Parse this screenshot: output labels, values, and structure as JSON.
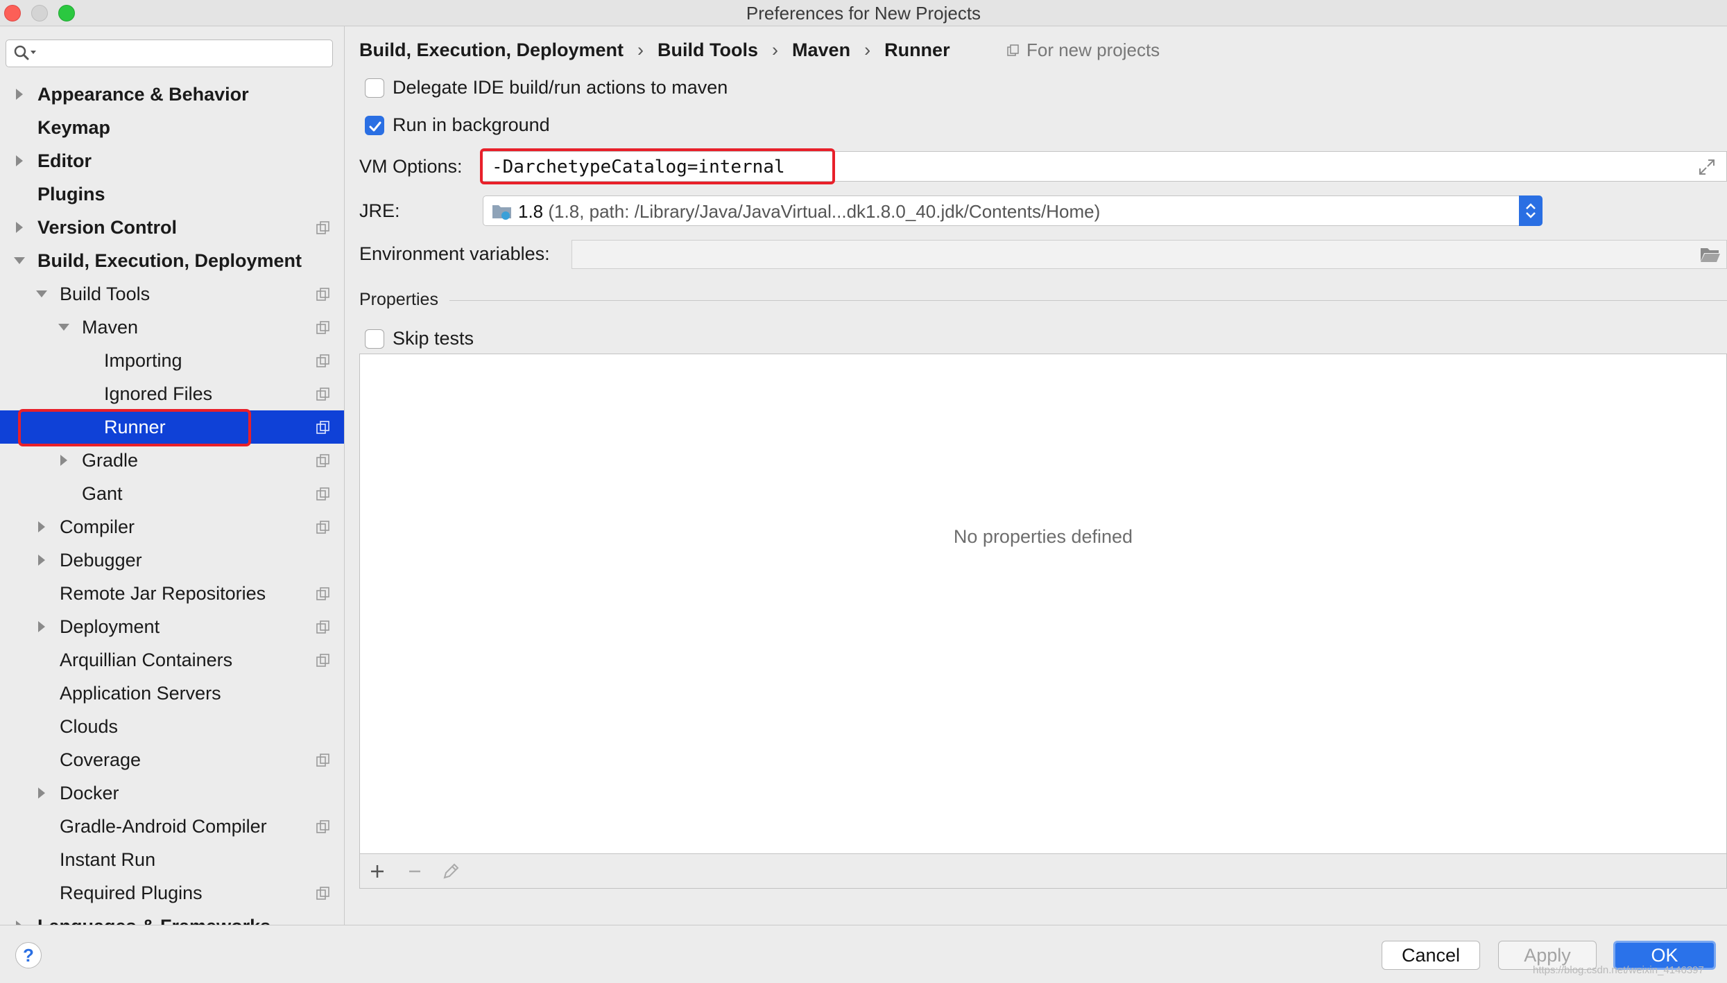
{
  "window": {
    "title": "Preferences for New Projects"
  },
  "sidebar": {
    "search": {
      "value": "",
      "placeholder": ""
    },
    "items": [
      {
        "label": "Appearance & Behavior",
        "level": 0,
        "arrow": "right",
        "bold": true,
        "copy": false
      },
      {
        "label": "Keymap",
        "level": 0,
        "arrow": "none",
        "bold": true,
        "copy": false
      },
      {
        "label": "Editor",
        "level": 0,
        "arrow": "right",
        "bold": true,
        "copy": false
      },
      {
        "label": "Plugins",
        "level": 0,
        "arrow": "none",
        "bold": true,
        "copy": false
      },
      {
        "label": "Version Control",
        "level": 0,
        "arrow": "right",
        "bold": true,
        "copy": true
      },
      {
        "label": "Build, Execution, Deployment",
        "level": 0,
        "arrow": "down",
        "bold": true,
        "copy": false
      },
      {
        "label": "Build Tools",
        "level": 1,
        "arrow": "down",
        "bold": false,
        "copy": true
      },
      {
        "label": "Maven",
        "level": 2,
        "arrow": "down",
        "bold": false,
        "copy": true
      },
      {
        "label": "Importing",
        "level": 3,
        "arrow": "none",
        "bold": false,
        "copy": true
      },
      {
        "label": "Ignored Files",
        "level": 3,
        "arrow": "none",
        "bold": false,
        "copy": true
      },
      {
        "label": "Runner",
        "level": 3,
        "arrow": "none",
        "bold": false,
        "copy": true,
        "selected": true
      },
      {
        "label": "Gradle",
        "level": 2,
        "arrow": "right",
        "bold": false,
        "copy": true
      },
      {
        "label": "Gant",
        "level": 2,
        "arrow": "none",
        "bold": false,
        "copy": true
      },
      {
        "label": "Compiler",
        "level": 1,
        "arrow": "right",
        "bold": false,
        "copy": true
      },
      {
        "label": "Debugger",
        "level": 1,
        "arrow": "right",
        "bold": false,
        "copy": false
      },
      {
        "label": "Remote Jar Repositories",
        "level": 1,
        "arrow": "none",
        "bold": false,
        "copy": true
      },
      {
        "label": "Deployment",
        "level": 1,
        "arrow": "right",
        "bold": false,
        "copy": true
      },
      {
        "label": "Arquillian Containers",
        "level": 1,
        "arrow": "none",
        "bold": false,
        "copy": true
      },
      {
        "label": "Application Servers",
        "level": 1,
        "arrow": "none",
        "bold": false,
        "copy": false
      },
      {
        "label": "Clouds",
        "level": 1,
        "arrow": "none",
        "bold": false,
        "copy": false
      },
      {
        "label": "Coverage",
        "level": 1,
        "arrow": "none",
        "bold": false,
        "copy": true
      },
      {
        "label": "Docker",
        "level": 1,
        "arrow": "right",
        "bold": false,
        "copy": false
      },
      {
        "label": "Gradle-Android Compiler",
        "level": 1,
        "arrow": "none",
        "bold": false,
        "copy": true
      },
      {
        "label": "Instant Run",
        "level": 1,
        "arrow": "none",
        "bold": false,
        "copy": false
      },
      {
        "label": "Required Plugins",
        "level": 1,
        "arrow": "none",
        "bold": false,
        "copy": true
      },
      {
        "label": "Languages & Frameworks",
        "level": 0,
        "arrow": "right",
        "bold": true,
        "copy": false
      }
    ]
  },
  "breadcrumb": {
    "items": [
      "Build, Execution, Deployment",
      "Build Tools",
      "Maven",
      "Runner"
    ],
    "separator": "›",
    "scope_note": "For new projects"
  },
  "runner": {
    "delegate_label": "Delegate IDE build/run actions to maven",
    "delegate_checked": false,
    "background_label": "Run in background",
    "background_checked": true,
    "vm_options_label": "VM Options:",
    "vm_options_value": "-DarchetypeCatalog=internal",
    "jre_label": "JRE:",
    "jre_version": "1.8",
    "jre_path": "(1.8, path: /Library/Java/JavaVirtual...dk1.8.0_40.jdk/Contents/Home)",
    "env_label": "Environment variables:",
    "env_value": ""
  },
  "properties": {
    "title": "Properties",
    "skip_tests_label": "Skip tests",
    "skip_tests_checked": false,
    "empty_text": "No properties defined"
  },
  "footer": {
    "help": "?",
    "cancel": "Cancel",
    "apply": "Apply",
    "ok": "OK",
    "watermark": "https://blog.csdn.net/weixin_4146397"
  },
  "colors": {
    "selection": "#0f41d7",
    "accent": "#2a6fe3",
    "highlight": "#e8202a"
  }
}
